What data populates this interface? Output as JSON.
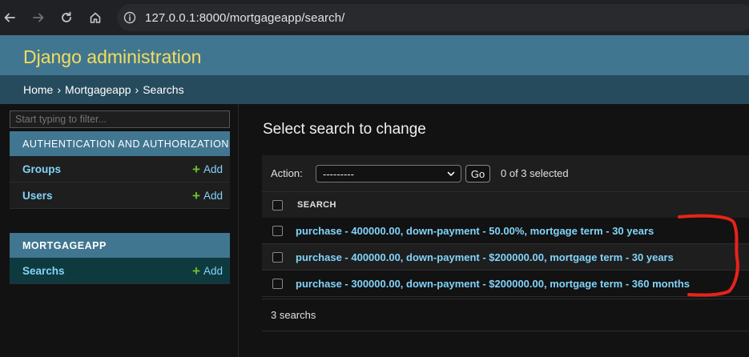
{
  "browser": {
    "url": "127.0.0.1:8000/mortgageapp/search/"
  },
  "header": {
    "branding": "Django administration"
  },
  "breadcrumbs": {
    "home": "Home",
    "app": "Mortgageapp",
    "current": "Searchs",
    "separator": "›"
  },
  "sidebar": {
    "filter_placeholder": "Start typing to filter...",
    "apps": [
      {
        "caption": "AUTHENTICATION AND AUTHORIZATION",
        "models": [
          {
            "label": "Groups",
            "add_label": "Add"
          },
          {
            "label": "Users",
            "add_label": "Add"
          }
        ]
      },
      {
        "caption": "MORTGAGEAPP",
        "models": [
          {
            "label": "Searchs",
            "add_label": "Add"
          }
        ]
      }
    ]
  },
  "content": {
    "title": "Select search to change",
    "action_label": "Action:",
    "action_selected": "---------",
    "go_label": "Go",
    "counter": "0 of 3 selected",
    "column_header": "SEARCH",
    "rows": [
      "purchase - 400000.00, down-payment - 50.00%, mortgage term - 30 years",
      "purchase - 400000.00, down-payment - $200000.00, mortgage term - 30 years",
      "purchase - 300000.00, down-payment - $200000.00, mortgage term - 360 months"
    ],
    "paginator": "3 searchs"
  },
  "colors": {
    "header_bg": "#417690",
    "branding": "#f5dd5d",
    "breadcrumbs_bg": "#264b5d",
    "link": "#81d4fa",
    "add_plus": "#70bf2b",
    "annotation": "#e8231a"
  }
}
